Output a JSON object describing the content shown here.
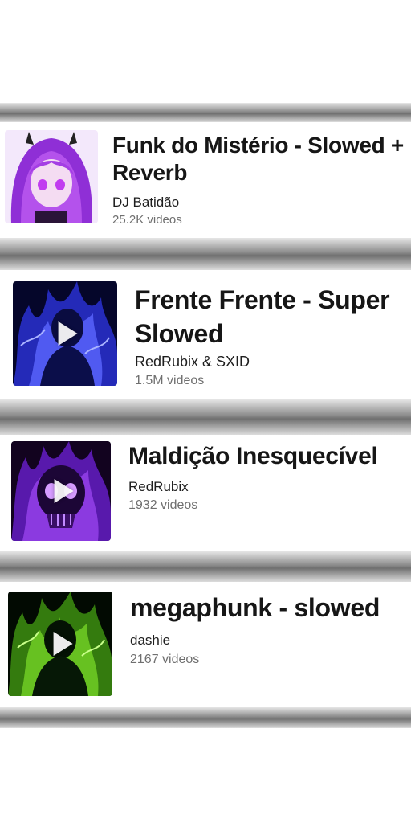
{
  "songs": [
    {
      "title": "Funk do Mistério - Slowed + Reverb",
      "artist": "DJ Batidão",
      "count": "25.2K videos",
      "thumbnail_icon": "anime-girl-purple-art",
      "play_icon": false
    },
    {
      "title": "Frente Frente - Super Slowed",
      "artist": "RedRubix & SXID",
      "count": "1.5M videos",
      "thumbnail_icon": "blue-flame-figure-art",
      "play_icon": true
    },
    {
      "title": "Maldição Inesquecível",
      "artist": "RedRubix",
      "count": "1932 videos",
      "thumbnail_icon": "purple-skull-art",
      "play_icon": true
    },
    {
      "title": "megaphunk - slowed",
      "artist": "dashie",
      "count": "2167 videos",
      "thumbnail_icon": "green-flame-figure-art",
      "play_icon": true
    }
  ],
  "colors": {
    "title": "#161616",
    "count": "#6f6f6f",
    "purple": "#b13cf0",
    "blue": "#2f37e8",
    "violet": "#8a2be2",
    "green": "#7ee02a"
  }
}
